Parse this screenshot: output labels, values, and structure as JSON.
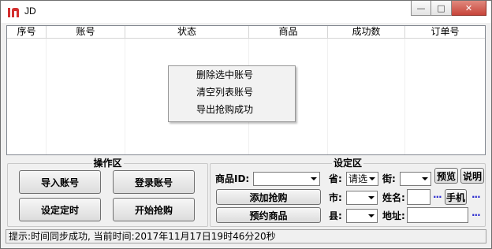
{
  "window": {
    "title": "JD",
    "minimize_glyph": "—",
    "maximize_glyph": "□",
    "close_glyph": "✕"
  },
  "list": {
    "columns": [
      "序号",
      "账号",
      "状态",
      "商品",
      "成功数",
      "订单号"
    ]
  },
  "context_menu": {
    "items": [
      "删除选中账号",
      "清空列表账号",
      "导出抢购成功"
    ]
  },
  "operation_group": {
    "title": "操作区",
    "import_label": "导入账号",
    "login_label": "登录账号",
    "timer_label": "设定定时",
    "start_label": "开始抢购"
  },
  "settings_group": {
    "title": "设定区",
    "product_id_label": "商品ID:",
    "product_id_value": "",
    "add_label": "添加抢购",
    "reserve_label": "预约商品",
    "province_label": "省:",
    "province_value": "请选",
    "street_label": "街:",
    "street_value": "",
    "preview_label": "预览",
    "help_label": "说明",
    "city_label": "市:",
    "city_value": "",
    "name_label": "姓名:",
    "name_value": "",
    "phone_label": "手机",
    "county_label": "县:",
    "county_value": "",
    "address_label": "地址:",
    "address_value": "",
    "more_glyph": "···"
  },
  "status": {
    "text": "提示:时间同步成功, 当前时间:2017年11月17日19时46分20秒"
  }
}
